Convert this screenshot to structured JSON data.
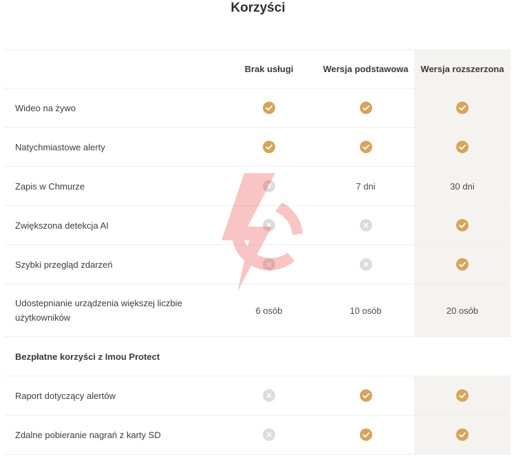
{
  "title": "Korzyści",
  "columns": [
    "",
    "Brak usługi",
    "Wersja podstawowa",
    "Wersja rozszerzona"
  ],
  "icons": {
    "yes": "check-circle-icon",
    "no": "cross-circle-icon"
  },
  "colors": {
    "check": "#d4a55a",
    "cross": "#dcdcdc",
    "highlight_column": "#f5f3ef"
  },
  "rows": [
    {
      "feature": "Wideo na żywo",
      "values": [
        "yes",
        "yes",
        "yes"
      ]
    },
    {
      "feature": "Natychmiastowe alerty",
      "values": [
        "yes",
        "yes",
        "yes"
      ]
    },
    {
      "feature": "Zapis w Chmurze",
      "values": [
        "no",
        "7 dni",
        "30 dni"
      ]
    },
    {
      "feature": "Zwiększona detekcja AI",
      "values": [
        "no",
        "no",
        "yes"
      ]
    },
    {
      "feature": "Szybki przegląd zdarzeń",
      "values": [
        "no",
        "no",
        "yes"
      ]
    },
    {
      "feature": "Udostepnianie urządzenia większej liczbie użytkowników",
      "values": [
        "6 osób",
        "10 osób",
        "20 osób"
      ]
    }
  ],
  "section_title": "Bezpłatne korzyści z Imou Protect",
  "free_rows": [
    {
      "feature": "Raport dotyczący alertów",
      "values": [
        "no",
        "yes",
        "yes"
      ]
    },
    {
      "feature": "Zdalne pobieranie nagrań z karty SD",
      "values": [
        "no",
        "yes",
        "yes"
      ]
    }
  ]
}
